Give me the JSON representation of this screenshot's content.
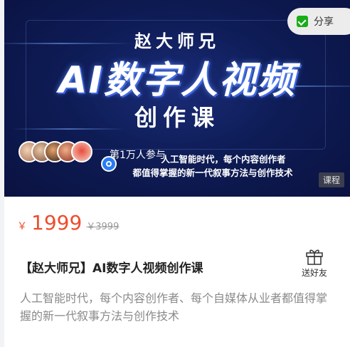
{
  "banner": {
    "brand": "赵大师兄",
    "title": "AI数字人视频",
    "title_line2": "创作课",
    "participants": "第1万人参与",
    "subtitle_line1": "人工智能时代，每个内容创作者",
    "subtitle_line2": "都值得掌握的新一代叙事方法与创作技术",
    "type_tag": "课程"
  },
  "share": {
    "label": "分享",
    "icon": "wechat-check-icon"
  },
  "price": {
    "currency": "￥",
    "current": "1999",
    "original": "￥3999",
    "color": "#ee4d2d"
  },
  "course": {
    "title": "【赵大师兄】AI数字人视频创作课",
    "description": "人工智能时代，每个内容创作者、每个自媒体从业者都值得掌握的新一代叙事方法与创作技术"
  },
  "gift": {
    "label": "送好友",
    "icon": "gift-icon"
  }
}
